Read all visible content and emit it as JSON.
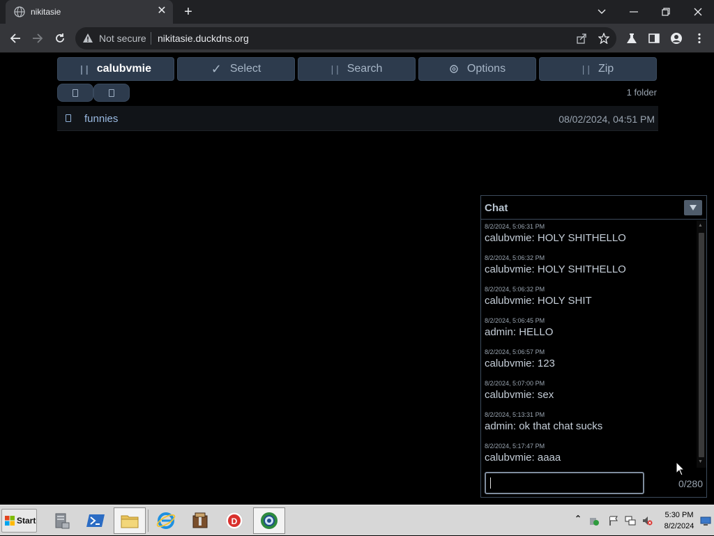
{
  "browser": {
    "tab_title": "nikitasie",
    "tab_close": "✕",
    "new_tab": "+",
    "security_label": "Not secure",
    "url": "nikitasie.duckdns.org"
  },
  "toolbar": {
    "user_button": "calubvmie",
    "select_button": "Select",
    "search_button": "Search",
    "options_button": "Options",
    "zip_button": "Zip",
    "folder_count": "1 folder"
  },
  "files": [
    {
      "name": "funnies",
      "date": "08/02/2024, 04:51 PM"
    }
  ],
  "chat": {
    "title": "Chat",
    "messages": [
      {
        "time": "8/2/2024, 5:06:31 PM",
        "text": "calubvmie: HOLY SHITHELLO"
      },
      {
        "time": "8/2/2024, 5:06:32 PM",
        "text": "calubvmie: HOLY SHITHELLO"
      },
      {
        "time": "8/2/2024, 5:06:32 PM",
        "text": "calubvmie: HOLY SHIT"
      },
      {
        "time": "8/2/2024, 5:06:45 PM",
        "text": "admin: HELLO"
      },
      {
        "time": "8/2/2024, 5:06:57 PM",
        "text": "calubvmie: 123"
      },
      {
        "time": "8/2/2024, 5:07:00 PM",
        "text": "calubvmie: sex"
      },
      {
        "time": "8/2/2024, 5:13:31 PM",
        "text": "admin: ok that chat sucks"
      },
      {
        "time": "8/2/2024, 5:17:47 PM",
        "text": "calubvmie: aaaa"
      }
    ],
    "input_value": "",
    "char_count": "0/280"
  },
  "taskbar": {
    "start_label": "Start",
    "clock_time": "5:30 PM",
    "clock_date": "8/2/2024"
  }
}
